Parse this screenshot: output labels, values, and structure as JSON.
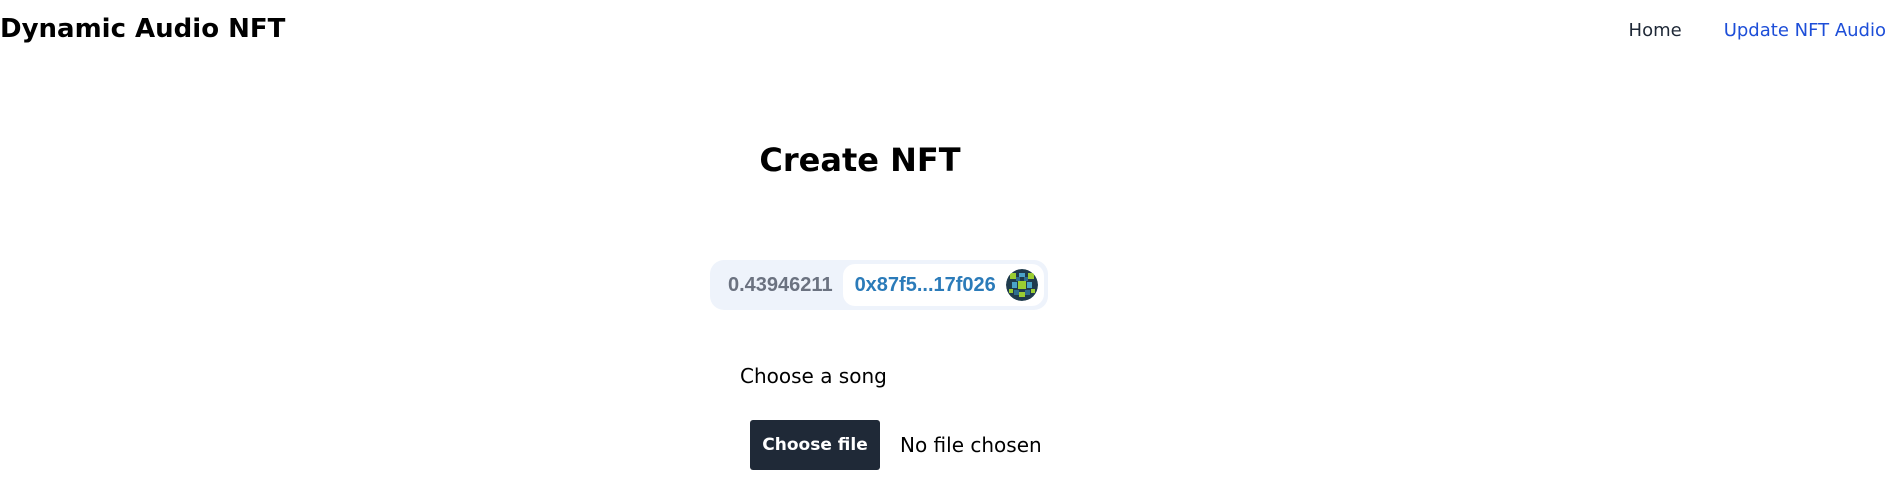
{
  "app": {
    "title": "Dynamic Audio NFT"
  },
  "nav": {
    "home_label": "Home",
    "update_label": "Update NFT Audio"
  },
  "main": {
    "heading": "Create NFT"
  },
  "wallet": {
    "balance": "0.43946211",
    "address": "0x87f5...17f026",
    "avatar_icon": "identicon-avatar"
  },
  "upload": {
    "label": "Choose a song",
    "button_label": "Choose file",
    "status": "No file chosen"
  },
  "colors": {
    "nav_active": "#1d4ed8",
    "nav_default": "#1f2937",
    "button_bg": "#1f2937",
    "wallet_bg": "#eef3fb",
    "address": "#2b7bb9",
    "balance": "#6b7280"
  }
}
